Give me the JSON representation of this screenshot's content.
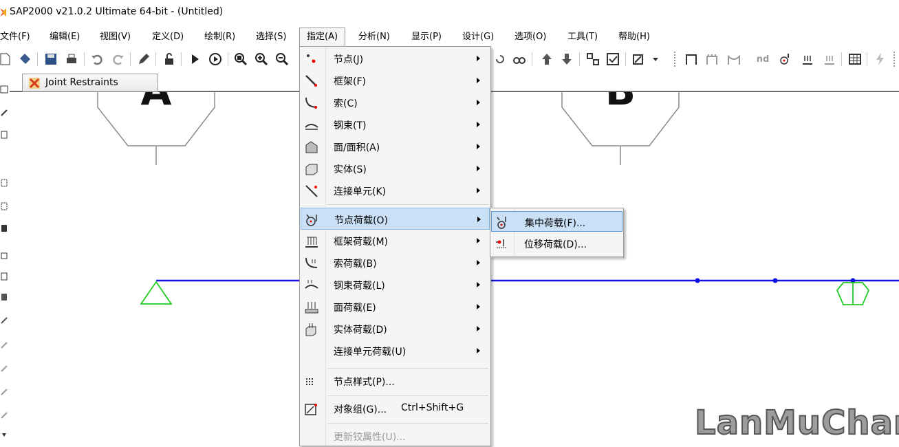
{
  "window": {
    "title": "SAP2000 v21.0.2 Ultimate 64-bit - (Untitled)"
  },
  "menubar": {
    "items": [
      {
        "label": "文件(F)"
      },
      {
        "label": "编辑(E)"
      },
      {
        "label": "视图(V)"
      },
      {
        "label": "定义(D)"
      },
      {
        "label": "绘制(R)"
      },
      {
        "label": "选择(S)"
      },
      {
        "label": "指定(A)"
      },
      {
        "label": "分析(N)"
      },
      {
        "label": "显示(P)"
      },
      {
        "label": "设计(G)"
      },
      {
        "label": "选项(O)"
      },
      {
        "label": "工具(T)"
      },
      {
        "label": "帮助(H)"
      }
    ]
  },
  "toolbar": {
    "nd_label": "nd"
  },
  "tabs": [
    {
      "label": "Joint Restraints"
    }
  ],
  "canvas": {
    "frame_color": "#1010e0",
    "support_color": "#22cc22",
    "grid_bubbles": [
      {
        "label": "A"
      },
      {
        "label": "B"
      }
    ],
    "watermark": "LanMuChan"
  },
  "assign_menu": {
    "items": [
      {
        "label": "节点(J)"
      },
      {
        "label": "框架(F)"
      },
      {
        "label": "索(C)"
      },
      {
        "label": "钢束(T)"
      },
      {
        "label": "面/面积(A)"
      },
      {
        "label": "实体(S)"
      },
      {
        "label": "连接单元(K)"
      },
      {
        "label": "节点荷载(O)"
      },
      {
        "label": "框架荷载(M)"
      },
      {
        "label": "索荷载(B)"
      },
      {
        "label": "钢束荷载(L)"
      },
      {
        "label": "面荷载(E)"
      },
      {
        "label": "实体荷载(D)"
      },
      {
        "label": "连接单元荷载(U)"
      },
      {
        "label": "节点样式(P)..."
      },
      {
        "label": "对象组(G)...",
        "shortcut": "Ctrl+Shift+G"
      },
      {
        "label": "更新铰属性(U)..."
      }
    ]
  },
  "joint_loads_submenu": {
    "items": [
      {
        "label": "集中荷载(F)..."
      },
      {
        "label": "位移荷载(D)..."
      }
    ]
  }
}
